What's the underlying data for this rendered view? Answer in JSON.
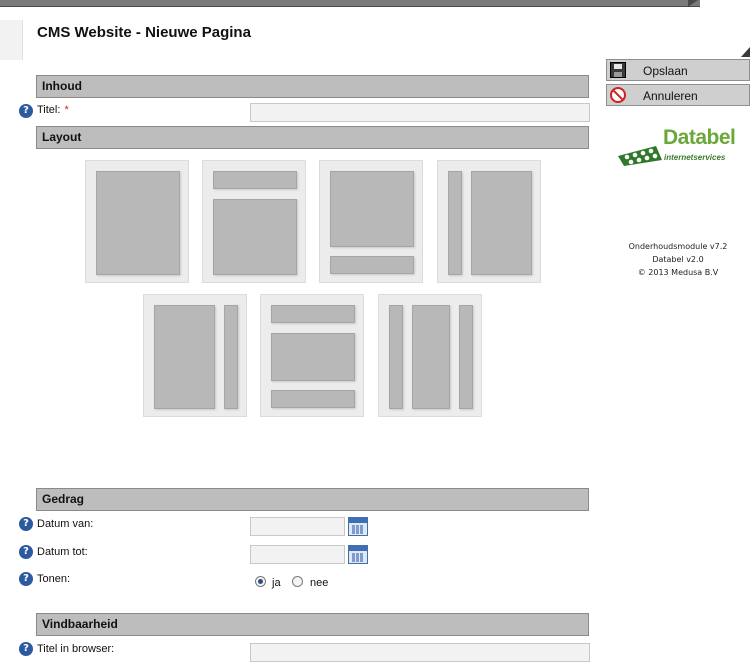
{
  "header": {
    "title": "CMS Website - Nieuwe Pagina"
  },
  "sections": {
    "inhoud": "Inhoud",
    "layout": "Layout",
    "gedrag": "Gedrag",
    "vindbaarheid": "Vindbaarheid"
  },
  "help_glyph": "?",
  "fields": {
    "titel": {
      "label": "Titel:",
      "required_mark": "*",
      "value": ""
    },
    "datum_van": {
      "label": "Datum van:",
      "value": ""
    },
    "datum_tot": {
      "label": "Datum tot:",
      "value": ""
    },
    "tonen": {
      "label": "Tonen:",
      "options": [
        "ja",
        "nee"
      ],
      "selected": "ja"
    },
    "titel_browser": {
      "label": "Titel in browser:",
      "value": ""
    }
  },
  "sidebar": {
    "save_label": "Opslaan",
    "cancel_label": "Annuleren",
    "logo_text": "Databel",
    "logo_sub": "internetservices",
    "version_lines": [
      "Onderhoudsmodule v7.2",
      "Databel v2.0",
      "© 2013 Medusa B.V"
    ]
  },
  "icons": {
    "help": "question-circle-icon",
    "calendar": "calendar-icon",
    "save": "floppy-disk-icon",
    "cancel": "no-entry-icon"
  },
  "colors": {
    "section_header": "#bdbdbd",
    "help_icon": "#2c5a9e",
    "required": "#cc2222",
    "logo_green": "#6aa83a"
  }
}
